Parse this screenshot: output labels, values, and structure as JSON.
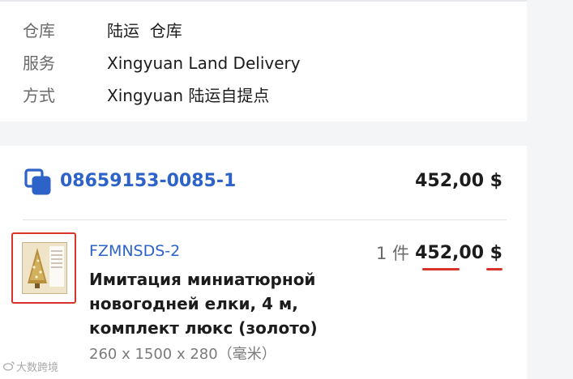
{
  "shipping_info": {
    "rows": [
      {
        "label": "仓库",
        "value": "陆运  仓库"
      },
      {
        "label": "服务",
        "value": "Xingyuan Land Delivery"
      },
      {
        "label": "方式",
        "value": "Xingyuan 陆运自提点"
      }
    ]
  },
  "order": {
    "icon": "copy-icon",
    "id": "08659153-0085-1",
    "total": "452,00 $"
  },
  "item": {
    "sku": "FZMNSDS-2",
    "name_lines": [
      "Имитация миниатюрной",
      "новогодней елки, 4 м,",
      "комплект люкс (золото)"
    ],
    "dimensions": "260 x 1500 x 280（毫米）",
    "quantity": "1 件",
    "price": "452,00 $"
  },
  "watermark": {
    "text": "大数跨境"
  },
  "colors": {
    "accent_blue": "#2d63c8",
    "highlight_red": "#d8332c"
  }
}
